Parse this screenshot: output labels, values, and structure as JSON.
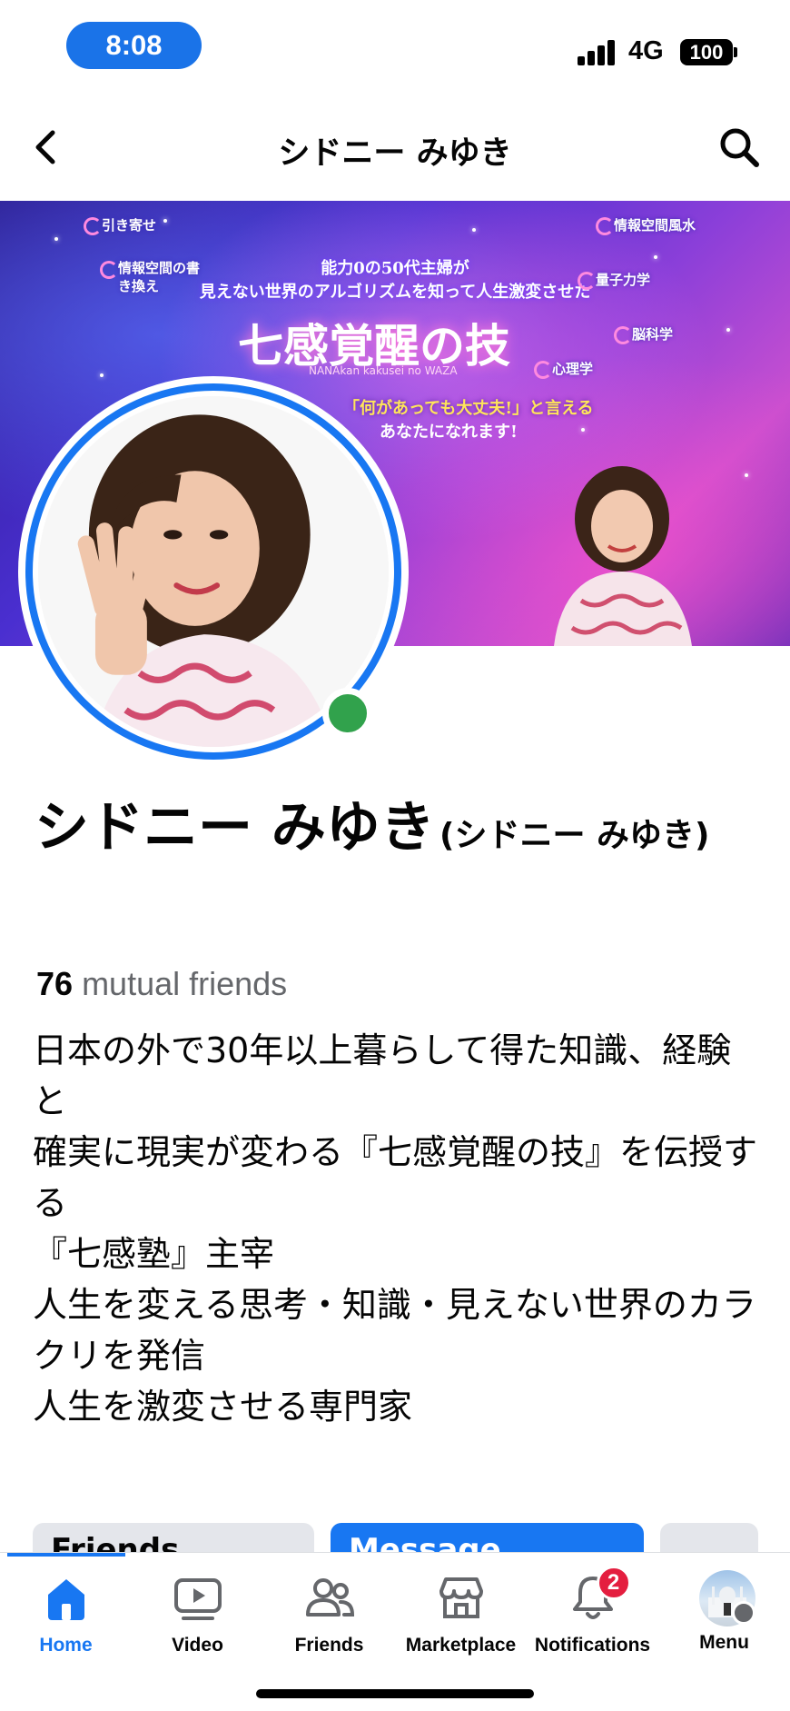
{
  "status_bar": {
    "time": "8:08",
    "network": "4G",
    "battery": "100"
  },
  "header": {
    "title": "シドニー みゆき"
  },
  "cover": {
    "line1": "能力0の50代主婦が",
    "line2": "見えない世界のアルゴリズムを知って人生激変させた",
    "title": "七感覚醒の技",
    "romaji": "NANAkan kakusei no WAZA",
    "tagline1": "「何があっても大丈夫!」と言える",
    "tagline2": "あなたになれます!",
    "badges": [
      "引き寄せ",
      "情報空間の書き換え",
      "情報空間風水",
      "量子力学",
      "脳科学",
      "心理学"
    ]
  },
  "profile": {
    "name": "シドニー みゆき",
    "alt_name": "(シドニー みゆき)",
    "mutual_count": "76",
    "mutual_label": "mutual friends",
    "online": true
  },
  "bio": [
    "日本の外で30年以上暮らして得た知識、経験と",
    "確実に現実が変わる『七感覚醒の技』を伝授する",
    "『七感塾』主宰",
    "人生を変える思考・知識・見えない世界のカラクリを発信",
    "人生を激変させる専門家"
  ],
  "actions": {
    "friends": "Friends",
    "message": "Message"
  },
  "bottom_nav": {
    "items": [
      {
        "label": "Home",
        "icon": "home-icon",
        "active": true
      },
      {
        "label": "Video",
        "icon": "video-icon"
      },
      {
        "label": "Friends",
        "icon": "friends-icon"
      },
      {
        "label": "Marketplace",
        "icon": "marketplace-icon"
      },
      {
        "label": "Notifications",
        "icon": "bell-icon",
        "badge": "2"
      },
      {
        "label": "Menu",
        "icon": "avatar-icon"
      }
    ]
  },
  "colors": {
    "accent": "#1877f2",
    "online": "#31a24c",
    "badge": "#e41e3f",
    "muted": "#65676b"
  }
}
